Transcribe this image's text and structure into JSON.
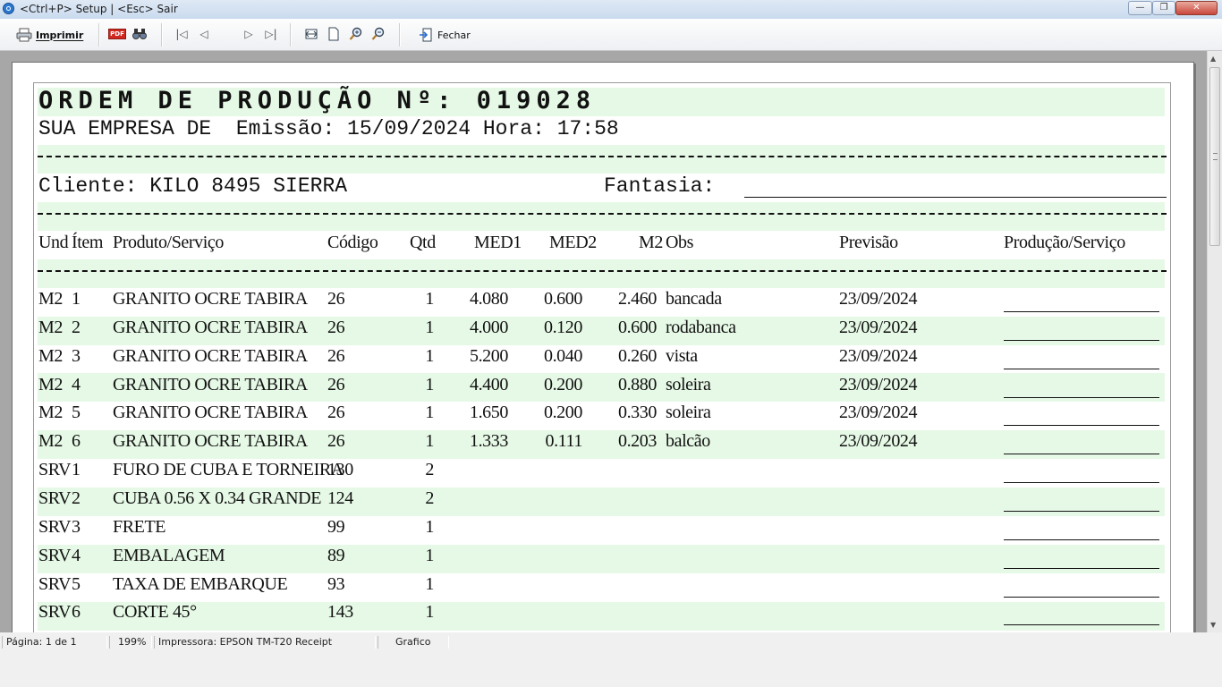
{
  "window": {
    "title": "<Ctrl+P> Setup | <Esc> Sair"
  },
  "toolbar": {
    "print_label": "Imprimir",
    "close_label": "Fechar",
    "pdf_icon_text": "PDF"
  },
  "report": {
    "title": "ORDEM DE PRODUÇÃO Nº: 019028",
    "company_line": "SUA EMPRESA DE  Emissão: 15/09/2024 Hora: 17:58",
    "dash_line": "------------------------------------------------------------------------------------------------",
    "client_line": "Cliente: KILO 8495 SIERRA",
    "fantasia_label": "Fantasia:",
    "columns": {
      "und": "Und",
      "item": "Ítem",
      "produto": "Produto/Serviço",
      "codigo": "Código",
      "qtd": "Qtd",
      "med1": "MED1",
      "med2": "MED2",
      "m2": "M2",
      "obs": "Obs",
      "previsao": "Previsão",
      "producao": "Produção/Serviço"
    },
    "rows": [
      {
        "und": "M2",
        "item": "1",
        "produto": "GRANITO OCRE TABIRA",
        "codigo": "26",
        "qtd": "1",
        "med1": "4.080",
        "med2": "0.600",
        "m2": "2.460",
        "obs": "bancada",
        "previsao": "23/09/2024"
      },
      {
        "und": "M2",
        "item": "2",
        "produto": "GRANITO OCRE TABIRA",
        "codigo": "26",
        "qtd": "1",
        "med1": "4.000",
        "med2": "0.120",
        "m2": "0.600",
        "obs": "rodabanca",
        "previsao": "23/09/2024"
      },
      {
        "und": "M2",
        "item": "3",
        "produto": "GRANITO OCRE TABIRA",
        "codigo": "26",
        "qtd": "1",
        "med1": "5.200",
        "med2": "0.040",
        "m2": "0.260",
        "obs": "vista",
        "previsao": "23/09/2024"
      },
      {
        "und": "M2",
        "item": "4",
        "produto": "GRANITO OCRE TABIRA",
        "codigo": "26",
        "qtd": "1",
        "med1": "4.400",
        "med2": "0.200",
        "m2": "0.880",
        "obs": "soleira",
        "previsao": "23/09/2024"
      },
      {
        "und": "M2",
        "item": "5",
        "produto": "GRANITO OCRE TABIRA",
        "codigo": "26",
        "qtd": "1",
        "med1": "1.650",
        "med2": "0.200",
        "m2": "0.330",
        "obs": "soleira",
        "previsao": "23/09/2024"
      },
      {
        "und": "M2",
        "item": "6",
        "produto": "GRANITO OCRE TABIRA",
        "codigo": "26",
        "qtd": "1",
        "med1": "1.333",
        "med2": "0.111",
        "m2": "0.203",
        "obs": "balcão",
        "previsao": "23/09/2024"
      },
      {
        "und": "SRV",
        "item": "1",
        "produto": "FURO DE CUBA E TORNEIRA",
        "codigo": "130",
        "qtd": "2",
        "med1": "",
        "med2": "",
        "m2": "",
        "obs": "",
        "previsao": ""
      },
      {
        "und": "SRV",
        "item": "2",
        "produto": "CUBA 0.56 X 0.34 GRANDE",
        "codigo": "124",
        "qtd": "2",
        "med1": "",
        "med2": "",
        "m2": "",
        "obs": "",
        "previsao": ""
      },
      {
        "und": "SRV",
        "item": "3",
        "produto": "FRETE",
        "codigo": "99",
        "qtd": "1",
        "med1": "",
        "med2": "",
        "m2": "",
        "obs": "",
        "previsao": ""
      },
      {
        "und": "SRV",
        "item": "4",
        "produto": "EMBALAGEM",
        "codigo": "89",
        "qtd": "1",
        "med1": "",
        "med2": "",
        "m2": "",
        "obs": "",
        "previsao": ""
      },
      {
        "und": "SRV",
        "item": "5",
        "produto": "TAXA DE EMBARQUE",
        "codigo": "93",
        "qtd": "1",
        "med1": "",
        "med2": "",
        "m2": "",
        "obs": "",
        "previsao": ""
      },
      {
        "und": "SRV",
        "item": "6",
        "produto": "CORTE 45°",
        "codigo": "143",
        "qtd": "1",
        "med1": "",
        "med2": "",
        "m2": "",
        "obs": "",
        "previsao": ""
      }
    ]
  },
  "status": {
    "page": "Página: 1 de 1",
    "zoom": "199%",
    "printer": "Impressora: EPSON TM-T20 Receipt",
    "mode": "Grafico"
  }
}
